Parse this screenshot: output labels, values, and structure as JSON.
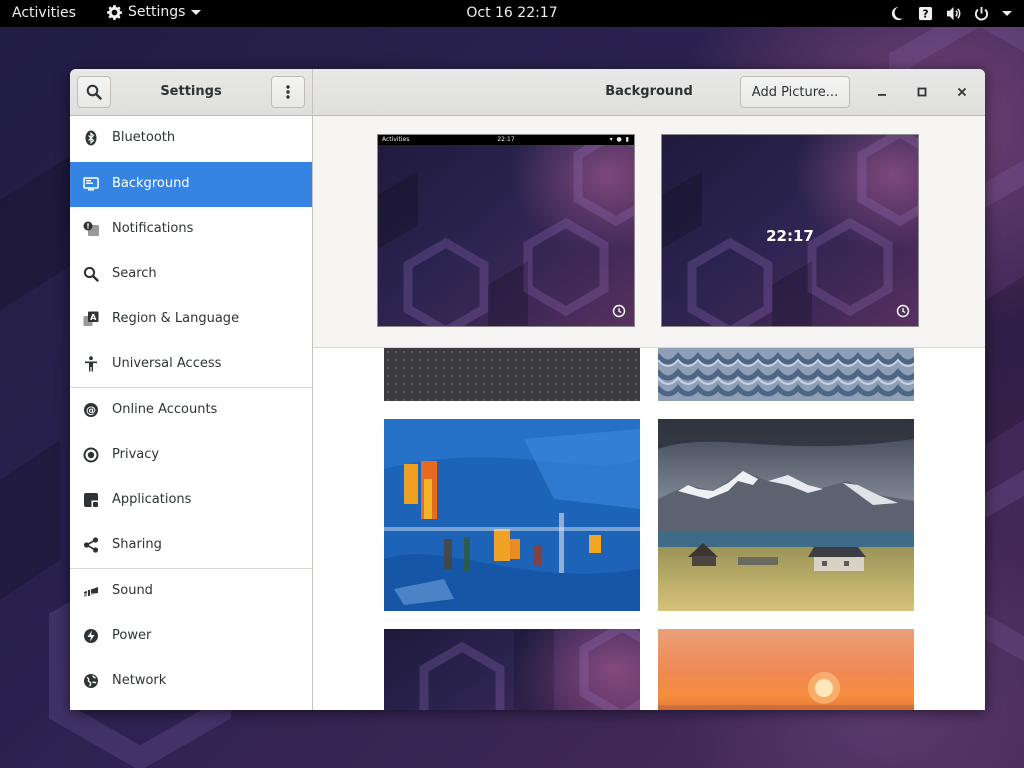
{
  "topbar": {
    "activities": "Activities",
    "app_name": "Settings",
    "clock": "Oct 16  22:17",
    "tray_icons": [
      "night-light-icon",
      "help-icon",
      "volume-icon",
      "power-icon",
      "chevron-down-icon"
    ]
  },
  "window": {
    "sidebar_title": "Settings",
    "panel_title": "Background",
    "add_picture_label": "Add Picture..."
  },
  "sidebar": {
    "items": [
      {
        "label": "Bluetooth",
        "icon": "bluetooth-icon"
      },
      {
        "label": "Background",
        "icon": "background-icon",
        "selected": true
      },
      {
        "label": "Notifications",
        "icon": "notifications-icon"
      },
      {
        "label": "Search",
        "icon": "search-icon"
      },
      {
        "label": "Region & Language",
        "icon": "region-language-icon"
      },
      {
        "label": "Universal Access",
        "icon": "universal-access-icon"
      },
      {
        "label": "Online Accounts",
        "icon": "online-accounts-icon"
      },
      {
        "label": "Privacy",
        "icon": "privacy-icon"
      },
      {
        "label": "Applications",
        "icon": "applications-icon"
      },
      {
        "label": "Sharing",
        "icon": "sharing-icon"
      },
      {
        "label": "Sound",
        "icon": "sound-icon"
      },
      {
        "label": "Power",
        "icon": "power-icon"
      },
      {
        "label": "Network",
        "icon": "network-icon"
      }
    ]
  },
  "previews": {
    "desktop": {
      "bar_activities": "Activities",
      "bar_clock": "22:17"
    },
    "lock": {
      "clock": "22:17"
    }
  },
  "wallpapers": [
    "dark-dots",
    "blue-knit",
    "blue-abstract-painting",
    "mountain-houses",
    "purple-hexagons",
    "orange-sunset"
  ],
  "colors": {
    "accent": "#3584e4",
    "topbar": "#000000",
    "headerbar": "#e8e8e7"
  }
}
